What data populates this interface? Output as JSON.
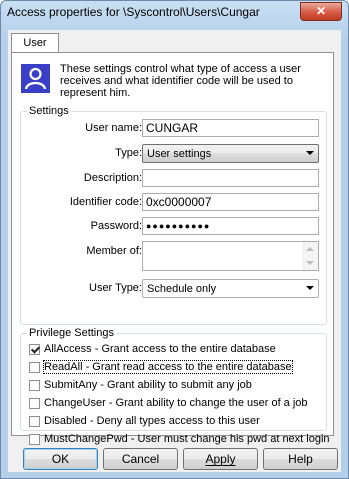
{
  "window": {
    "title": "Access properties for \\Syscontrol\\Users\\Cungar",
    "close_glyph": "✕"
  },
  "tabs": [
    {
      "label": "User"
    }
  ],
  "info": {
    "icon": "user-icon",
    "text": "These settings control what type of access a user receives and what identifier code will be used to represent him."
  },
  "settings": {
    "group_title": "Settings",
    "user_name": {
      "label": "User name:",
      "value": "CUNGAR"
    },
    "type": {
      "label": "Type:",
      "value": "User settings"
    },
    "description": {
      "label": "Description:",
      "value": ""
    },
    "identifier": {
      "label": "Identifier code:",
      "value": "0xc0000007"
    },
    "password": {
      "label": "Password:",
      "value": "●●●●●●●●●●"
    },
    "member_of": {
      "label": "Member of:"
    },
    "user_type": {
      "label": "User Type:",
      "value": "Schedule only"
    }
  },
  "privileges": {
    "group_title": "Privilege Settings",
    "items": [
      {
        "label": "AllAccess - Grant access to the entire database",
        "checked": true
      },
      {
        "label": "ReadAll - Grant read access to the entire database",
        "checked": false
      },
      {
        "label": "SubmitAny - Grant ability to submit any job",
        "checked": false
      },
      {
        "label": "ChangeUser - Grant ability to change the user of a job",
        "checked": false
      },
      {
        "label": "Disabled - Deny all types access to this user",
        "checked": false
      },
      {
        "label": "MustChangePwd - User must change his pwd at next login",
        "checked": false
      }
    ]
  },
  "buttons": {
    "ok": "OK",
    "cancel": "Cancel",
    "apply": "Apply",
    "help": "Help"
  }
}
